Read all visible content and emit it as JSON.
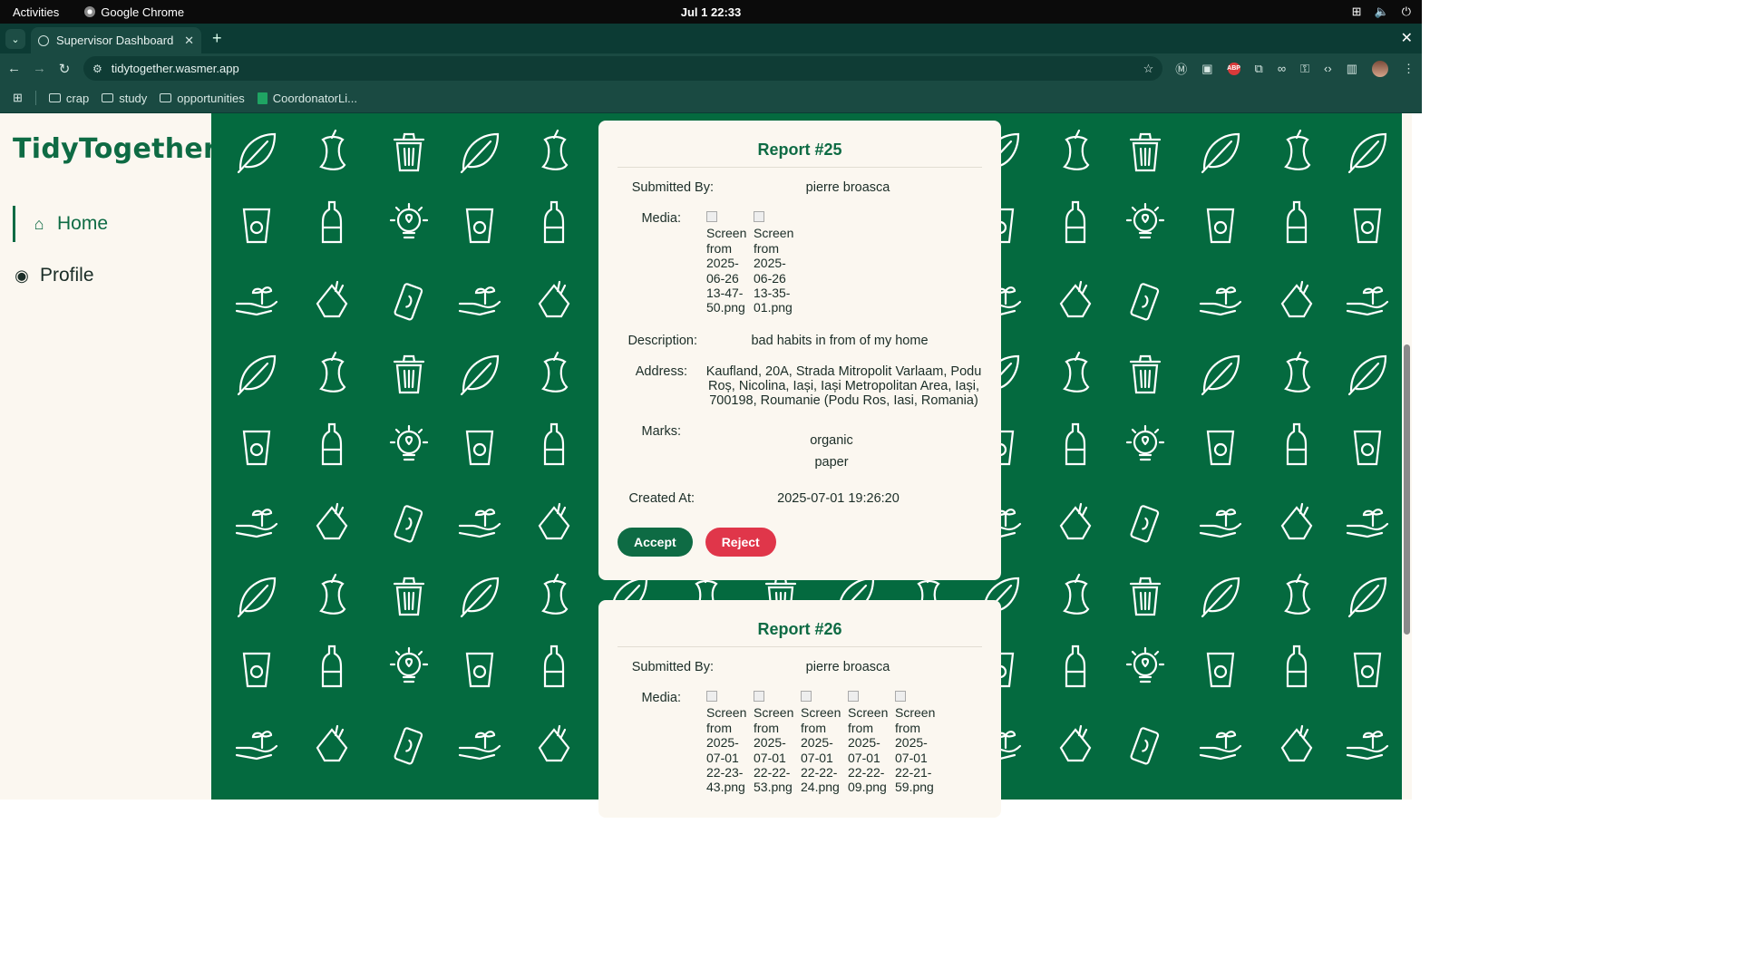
{
  "os": {
    "activities": "Activities",
    "app_name": "Google Chrome",
    "clock": "Jul 1  22:33"
  },
  "browser": {
    "tab_title": "Supervisor Dashboard",
    "url": "tidytogether.wasmer.app",
    "bookmarks": [
      "crap",
      "study",
      "opportunities",
      "CoordonatorLi..."
    ]
  },
  "sidebar": {
    "logo": "TidyTogether",
    "items": [
      {
        "label": "Home",
        "icon": "home-icon"
      },
      {
        "label": "Profile",
        "icon": "user-circle-icon"
      }
    ]
  },
  "reports": [
    {
      "title": "Report #25",
      "submitted_by_label": "Submitted By:",
      "submitted_by": "pierre broasca",
      "media_label": "Media:",
      "media": [
        "Screen from 2025-06-26 13-47-50.png",
        "Screen from 2025-06-26 13-35-01.png"
      ],
      "description_label": "Description:",
      "description": "bad habits in from of my home",
      "address_label": "Address:",
      "address": "Kaufland, 20A, Strada Mitropolit Varlaam, Podu Roș, Nicolina, Iași, Iași Metropolitan Area, Iași, 700198, Roumanie (Podu Ros, Iasi, Romania)",
      "marks_label": "Marks:",
      "marks": [
        "organic",
        "paper"
      ],
      "created_label": "Created At:",
      "created_at": "2025-07-01 19:26:20",
      "accept": "Accept",
      "reject": "Reject"
    },
    {
      "title": "Report #26",
      "submitted_by_label": "Submitted By:",
      "submitted_by": "pierre broasca",
      "media_label": "Media:",
      "media": [
        "Screen from 2025-07-01 22-23-43.png",
        "Screen from 2025-07-01 22-22-53.png",
        "Screen from 2025-07-01 22-22-24.png",
        "Screen from 2025-07-01 22-22-09.png",
        "Screen from 2025-07-01 22-21-59.png"
      ]
    }
  ],
  "colors": {
    "brand": "#0e6b44",
    "background": "#046a3f",
    "reject": "#e0364a",
    "card": "#fbf7f0"
  }
}
